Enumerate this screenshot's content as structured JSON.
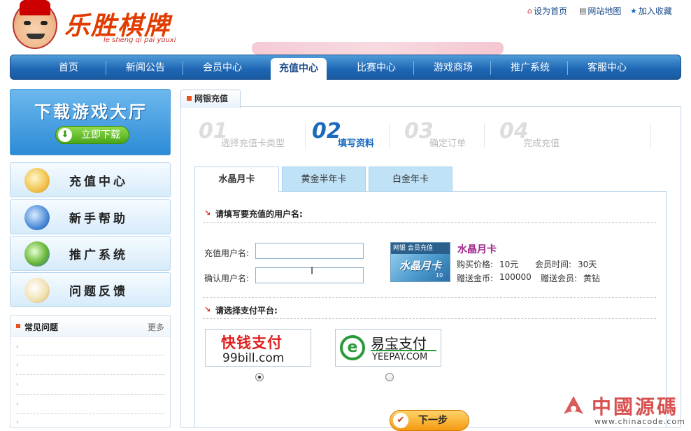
{
  "header": {
    "logo_text": "乐胜棋牌",
    "logo_pinyin": "le sheng qi pai youxi",
    "links": [
      {
        "label": "设为首页",
        "icon": "home-icon"
      },
      {
        "label": "网站地图",
        "icon": "map-icon"
      },
      {
        "label": "加入收藏",
        "icon": "star-icon"
      }
    ]
  },
  "nav": {
    "items": [
      "首页",
      "新闻公告",
      "会员中心",
      "充值中心",
      "比赛中心",
      "游戏商场",
      "推广系统",
      "客服中心"
    ],
    "active_index": 3
  },
  "sidebar": {
    "download": {
      "title": "下载游戏大厅",
      "button": "立即下载"
    },
    "menu": [
      {
        "label": "充值中心",
        "icon": "coins-icon"
      },
      {
        "label": "新手帮助",
        "icon": "book-icon"
      },
      {
        "label": "推广系统",
        "icon": "globe-icon"
      },
      {
        "label": "问题反馈",
        "icon": "letter-icon"
      }
    ],
    "faq": {
      "title": "常见问题",
      "more": "更多"
    }
  },
  "main": {
    "tab_title": "网银充值",
    "steps": [
      {
        "num": "01",
        "label": "选择充值卡类型",
        "active": false
      },
      {
        "num": "02",
        "label": "填写资料",
        "active": true
      },
      {
        "num": "03",
        "label": "确定订单",
        "active": false
      },
      {
        "num": "04",
        "label": "完成充值",
        "active": false
      }
    ],
    "card_tabs": [
      "水晶月卡",
      "黄金半年卡",
      "白金年卡"
    ],
    "active_card_tab": 0,
    "section_username": "请填写要充值的用户名:",
    "field_username_label": "充值用户名:",
    "field_username_value": "",
    "field_confirm_label": "确认用户名:",
    "field_confirm_value": "",
    "card": {
      "image_top": "网银 会员充值",
      "image_text": "水晶月卡",
      "image_corner": "10",
      "name": "水晶月卡",
      "price_label": "购买价格:",
      "price": "10元",
      "time_label": "会员时间:",
      "time": "30天",
      "gold_label": "赠送金币:",
      "gold": "100000",
      "member_label": "赠送会员:",
      "member": "黄钻"
    },
    "section_payment": "请选择支付平台:",
    "payments": [
      {
        "name": "快钱支付",
        "sub": "99bill.com",
        "selected": true
      },
      {
        "name": "易宝支付",
        "sub": "YEEPAY.COM",
        "selected": false
      }
    ],
    "next_button": "下一步"
  },
  "watermark": {
    "text": "中國源碼",
    "url": "www.chinacode.com"
  },
  "colors": {
    "nav_blue": "#1e66b4",
    "accent_orange": "#e8531c",
    "step_active": "#1a6bbe",
    "card_name": "#a0278a"
  }
}
